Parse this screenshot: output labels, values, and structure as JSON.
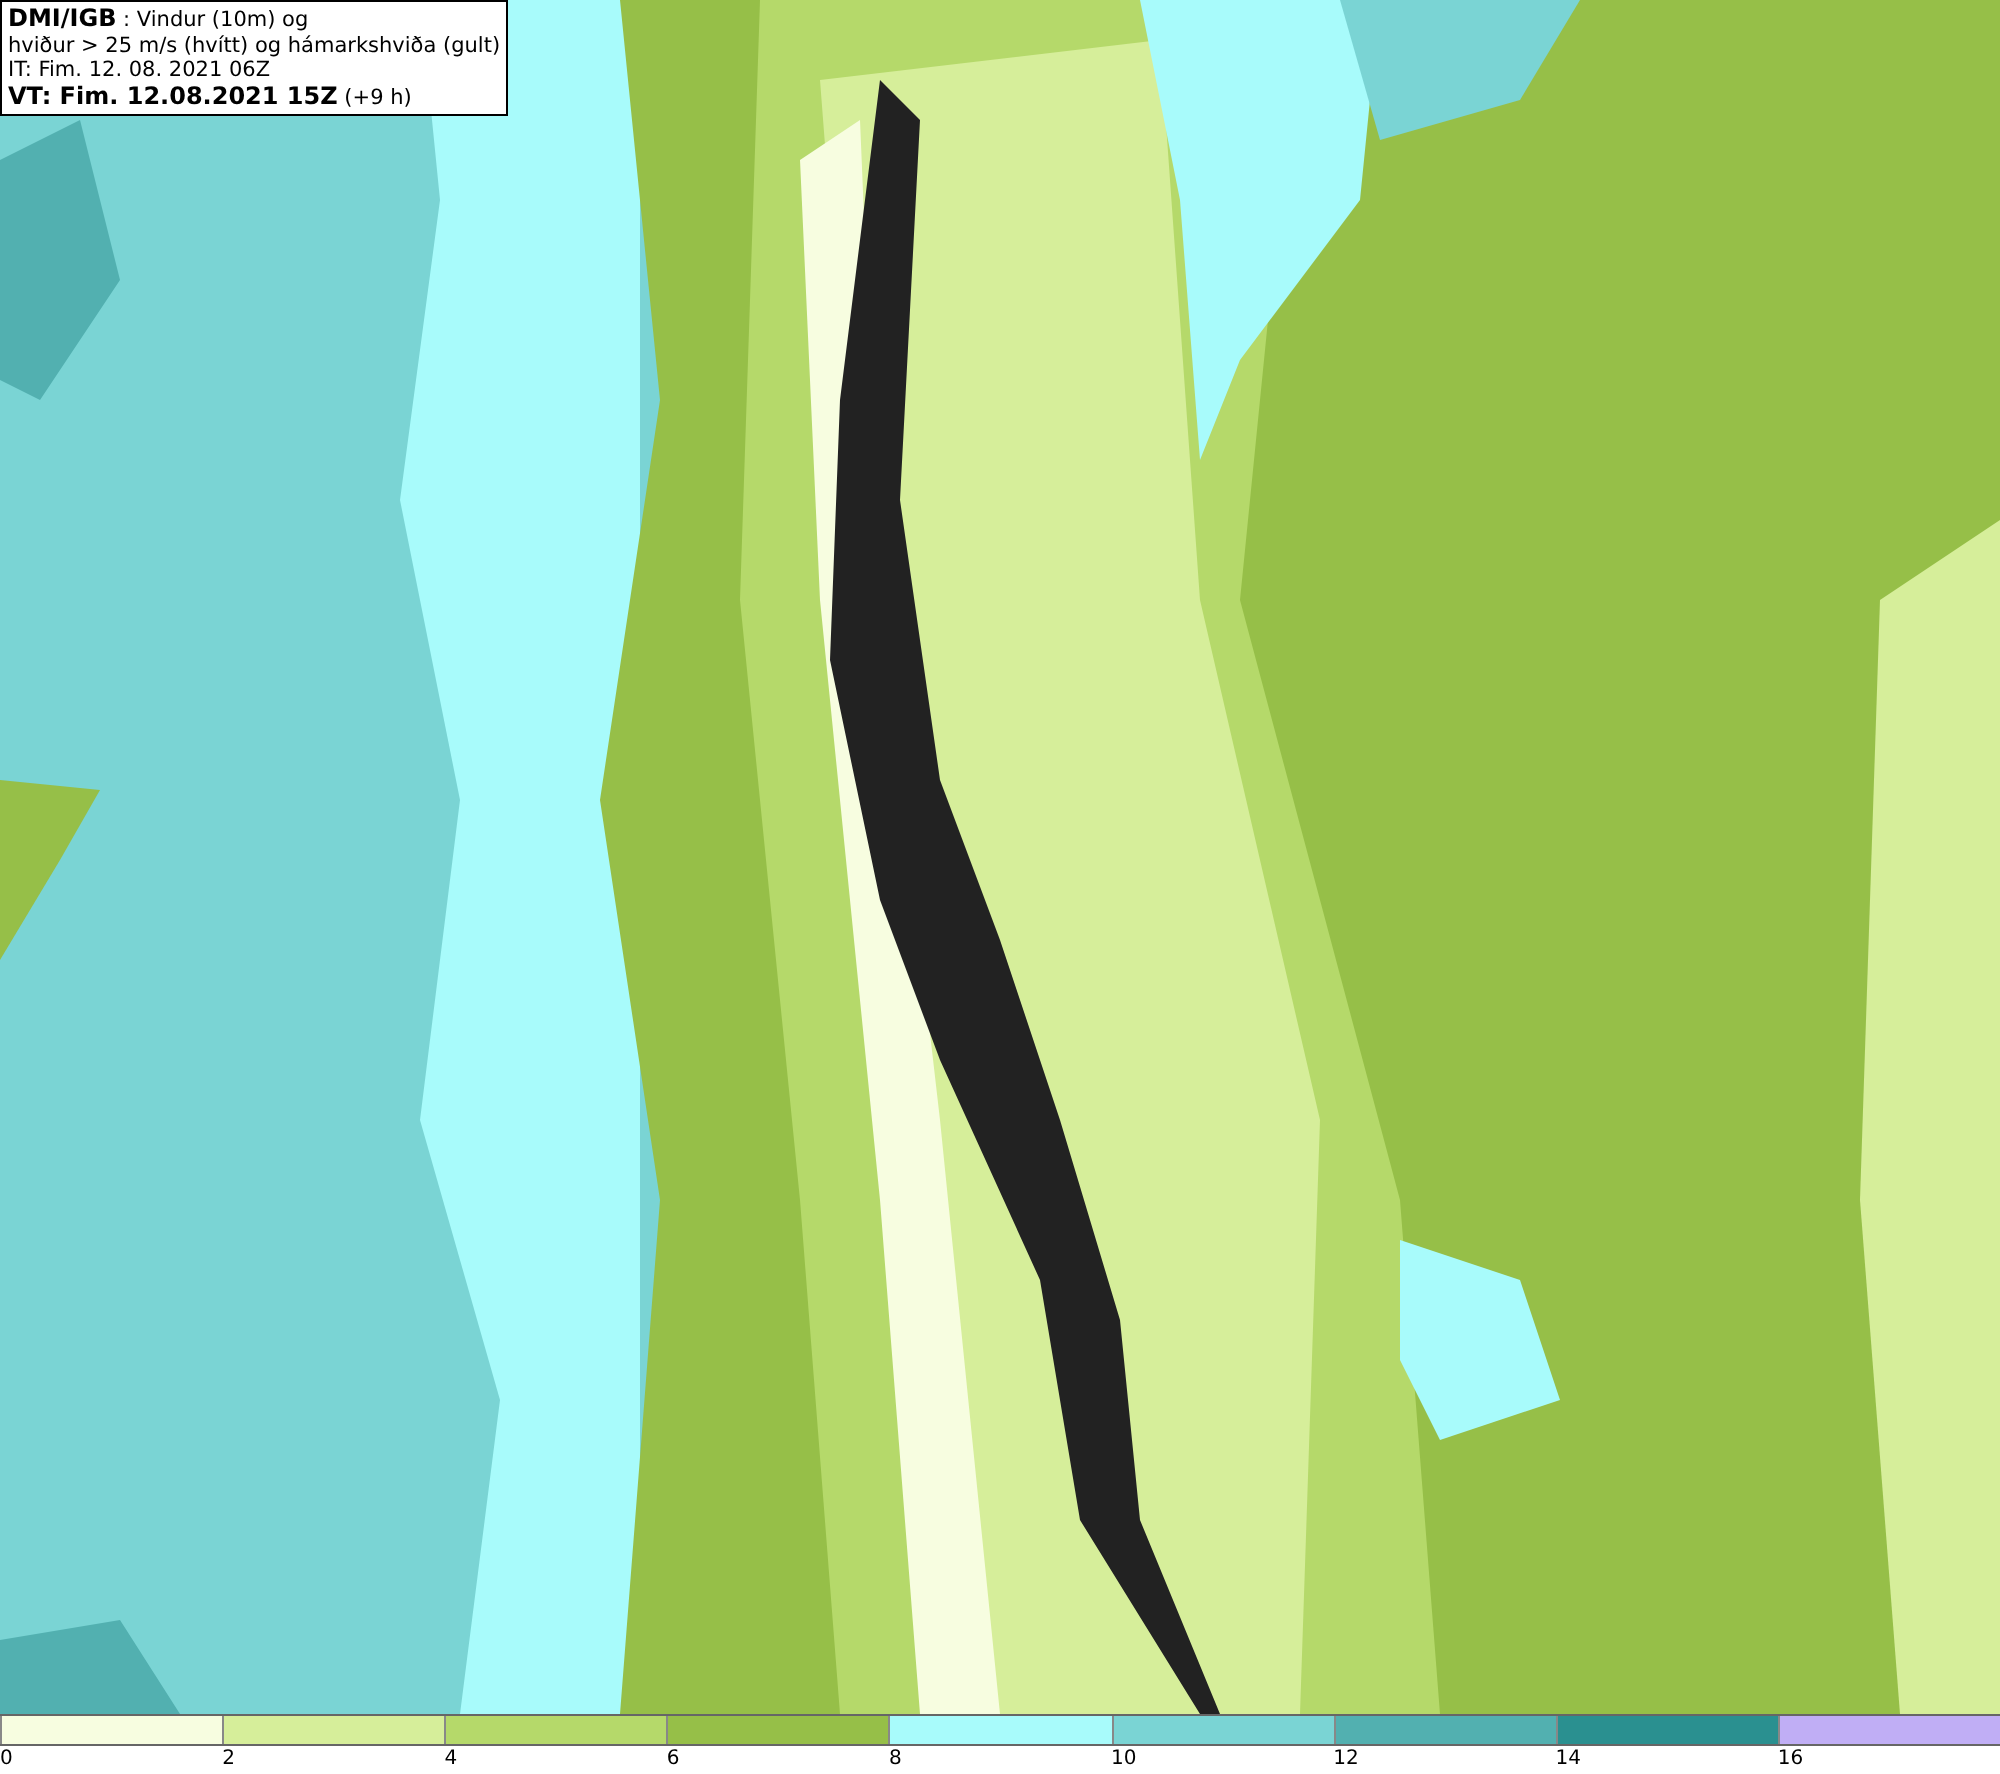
{
  "title_box": {
    "lines": [
      "**DMI/IGB** : Vindur (10m) og",
      "hviður > 25 m/s (hvítt) og hámarkshviða (gult)",
      "IT: Fim. 12. 08. 2021 06Z",
      "**VT: Fim. 12.08.2021 15Z** (+9 h)"
    ]
  },
  "legend": {
    "bins": [
      {
        "color": "#f7fde0",
        "label": "0"
      },
      {
        "color": "#d6ee9a",
        "label": "2"
      },
      {
        "color": "#b5d96a",
        "label": "4"
      },
      {
        "color": "#96bf48",
        "label": "6"
      },
      {
        "color": "#a8fbfb",
        "label": "8"
      },
      {
        "color": "#7ad4d4",
        "label": "10"
      },
      {
        "color": "#52b0b0",
        "label": "12"
      },
      {
        "color": "#2a9090",
        "label": "14"
      },
      {
        "color": "#c0aef5",
        "label": "16"
      }
    ]
  }
}
